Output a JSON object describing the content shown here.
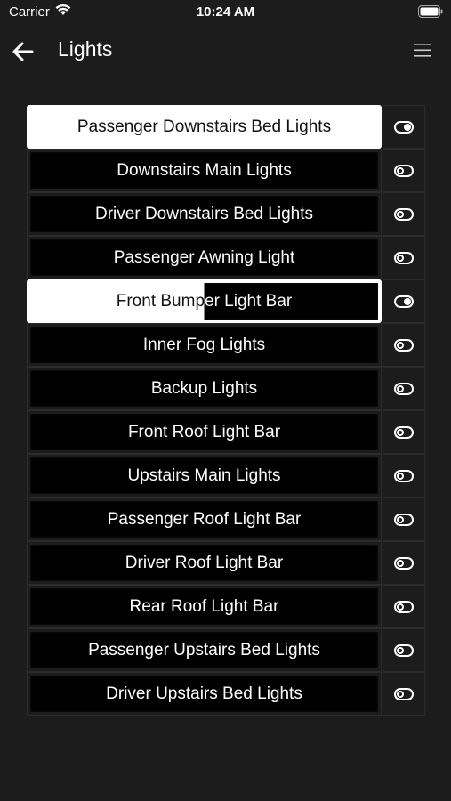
{
  "status_bar": {
    "carrier": "Carrier",
    "time": "10:24 AM"
  },
  "nav": {
    "title": "Lights"
  },
  "lights": [
    {
      "label": "Passenger Downstairs Bed Lights",
      "state": "on",
      "level": 1.0
    },
    {
      "label": "Downstairs Main Lights",
      "state": "off",
      "level": 0
    },
    {
      "label": "Driver Downstairs Bed Lights",
      "state": "off",
      "level": 0
    },
    {
      "label": "Passenger Awning Light",
      "state": "off",
      "level": 0
    },
    {
      "label": "Front Bumper Light Bar",
      "state": "on",
      "level": 0.5
    },
    {
      "label": "Inner Fog Lights",
      "state": "off",
      "level": 0
    },
    {
      "label": "Backup Lights",
      "state": "off",
      "level": 0
    },
    {
      "label": "Front Roof Light Bar",
      "state": "off",
      "level": 0
    },
    {
      "label": "Upstairs Main Lights",
      "state": "off",
      "level": 0
    },
    {
      "label": "Passenger Roof Light Bar",
      "state": "off",
      "level": 0
    },
    {
      "label": "Driver Roof Light Bar",
      "state": "off",
      "level": 0
    },
    {
      "label": "Rear Roof Light Bar",
      "state": "off",
      "level": 0
    },
    {
      "label": "Passenger Upstairs Bed Lights",
      "state": "off",
      "level": 0
    },
    {
      "label": "Driver Upstairs Bed Lights",
      "state": "off",
      "level": 0
    }
  ],
  "icons": {
    "back": "back-arrow-icon",
    "menu": "hamburger-menu-icon",
    "wifi": "wifi-icon",
    "battery": "battery-icon",
    "toggle": "toggle-icon"
  }
}
